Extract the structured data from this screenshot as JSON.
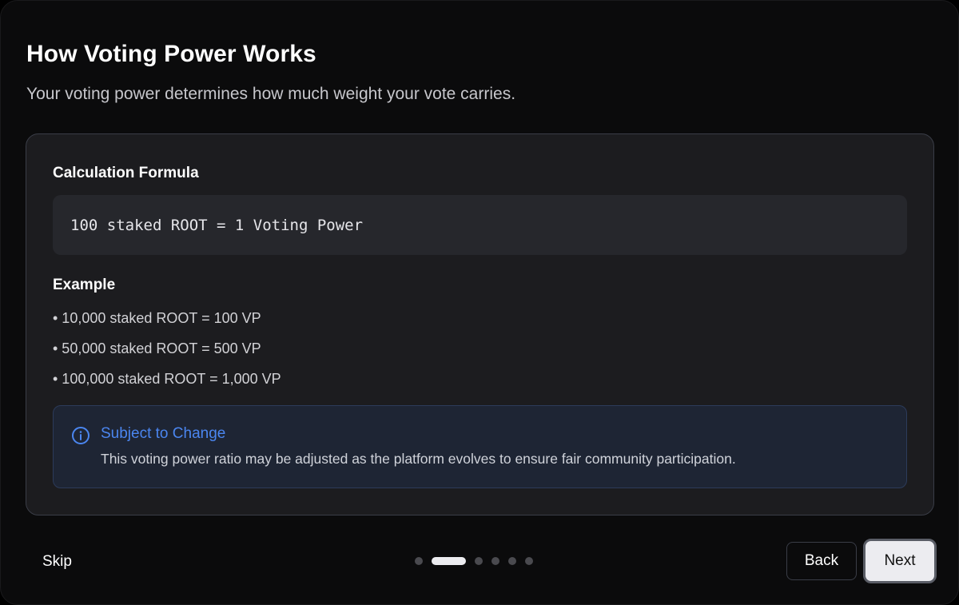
{
  "dialog": {
    "title": "How Voting Power Works",
    "subtitle": "Your voting power determines how much weight your vote carries."
  },
  "card": {
    "formula_heading": "Calculation Formula",
    "formula": "100 staked ROOT = 1 Voting Power",
    "example_heading": "Example",
    "examples": [
      "• 10,000 staked ROOT = 100 VP",
      "• 50,000 staked ROOT = 500 VP",
      "• 100,000 staked ROOT = 1,000 VP"
    ],
    "notice": {
      "icon": "info-icon",
      "title": "Subject to Change",
      "text": "This voting power ratio may be adjusted as the platform evolves to ensure fair community participation."
    }
  },
  "footer": {
    "skip_label": "Skip",
    "back_label": "Back",
    "next_label": "Next",
    "steps_total": 6,
    "current_step": 2
  },
  "colors": {
    "background": "#0b0b0c",
    "card": "#1c1c1f",
    "accent": "#4b86f0",
    "notice_bg": "#1e2534"
  }
}
